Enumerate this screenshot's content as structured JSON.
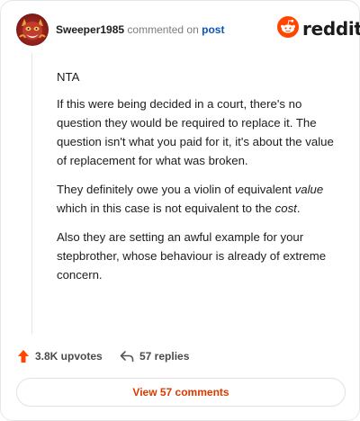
{
  "header": {
    "username": "Sweeper1985",
    "commented_text": "commented on",
    "post_link": "post",
    "logo_word": "reddit"
  },
  "comment": {
    "p1": "NTA",
    "p2": "If this were being decided in a court, there's no question they would be required to replace it. The question isn't what you paid for it, it's about the value of replacement for what was broken.",
    "p3_a": "They definitely owe you a violin of equivalent ",
    "p3_em1": "value",
    "p3_b": " which in this case is not equivalent to the ",
    "p3_em2": "cost",
    "p3_c": ".",
    "p4": "Also they are setting an awful example for your stepbrother, whose behaviour is already of extreme concern."
  },
  "actions": {
    "upvotes": "3.8K upvotes",
    "replies": "57 replies"
  },
  "footer": {
    "view_comments": "View 57 comments"
  },
  "colors": {
    "accent": "#ff4500",
    "link": "#0a56b8",
    "button_text": "#d93a00"
  },
  "icons": {
    "upvote": "upvote-arrow-icon",
    "reply": "reply-arrow-icon",
    "logo": "reddit-snoo-icon"
  }
}
